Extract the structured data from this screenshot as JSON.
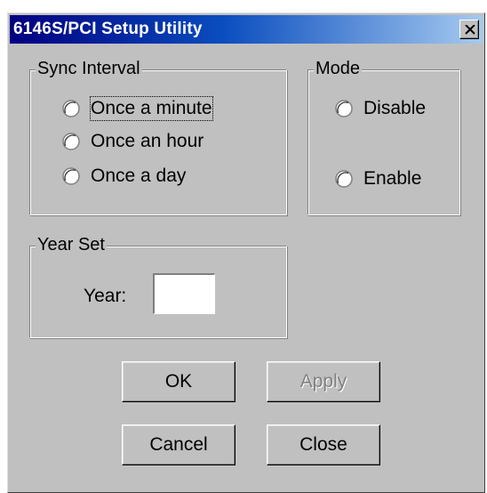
{
  "window": {
    "title": "6146S/PCI Setup Utility"
  },
  "sync_interval": {
    "legend": "Sync Interval",
    "options": [
      {
        "label": "Once a minute"
      },
      {
        "label": "Once an hour"
      },
      {
        "label": "Once a day"
      }
    ]
  },
  "mode": {
    "legend": "Mode",
    "options": [
      {
        "label": "Disable"
      },
      {
        "label": "Enable"
      }
    ]
  },
  "year_set": {
    "legend": "Year Set",
    "year_label": "Year:",
    "year_value": ""
  },
  "buttons": {
    "ok": "OK",
    "apply": "Apply",
    "cancel": "Cancel",
    "close": "Close"
  }
}
